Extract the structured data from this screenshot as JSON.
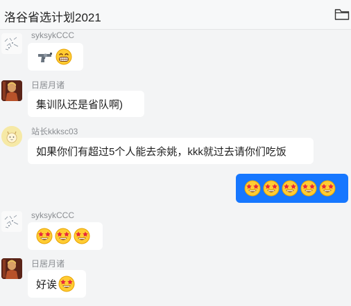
{
  "header": {
    "title": "洛谷省选计划2021",
    "folder_icon": "folder-icon"
  },
  "messages": [
    {
      "sender": "syksykCCC",
      "avatar": "doodle-avatar",
      "content": [
        "revolver-emoji",
        "grinning-emoji"
      ]
    },
    {
      "sender": "日居月诸",
      "avatar": "portrait-avatar",
      "text": "集训队还是省队啊)"
    },
    {
      "sender": "站长kkksc03",
      "avatar": "cat-avatar",
      "text": "如果你们有超过5个人能去余姚，kkk就过去请你们吃饭"
    },
    {
      "sender": "self",
      "content": [
        "star-struck-emoji",
        "star-struck-emoji",
        "star-struck-emoji",
        "star-struck-emoji",
        "star-struck-emoji"
      ]
    },
    {
      "sender": "syksykCCC",
      "avatar": "doodle-avatar",
      "content": [
        "star-struck-emoji",
        "star-struck-emoji",
        "star-struck-emoji"
      ]
    },
    {
      "sender": "日居月诸",
      "avatar": "portrait-avatar",
      "text": "好诶",
      "content": [
        "star-struck-emoji"
      ]
    }
  ],
  "colors": {
    "self_bubble": "#1677ff",
    "background": "#f3f4f5",
    "bubble": "#ffffff"
  }
}
